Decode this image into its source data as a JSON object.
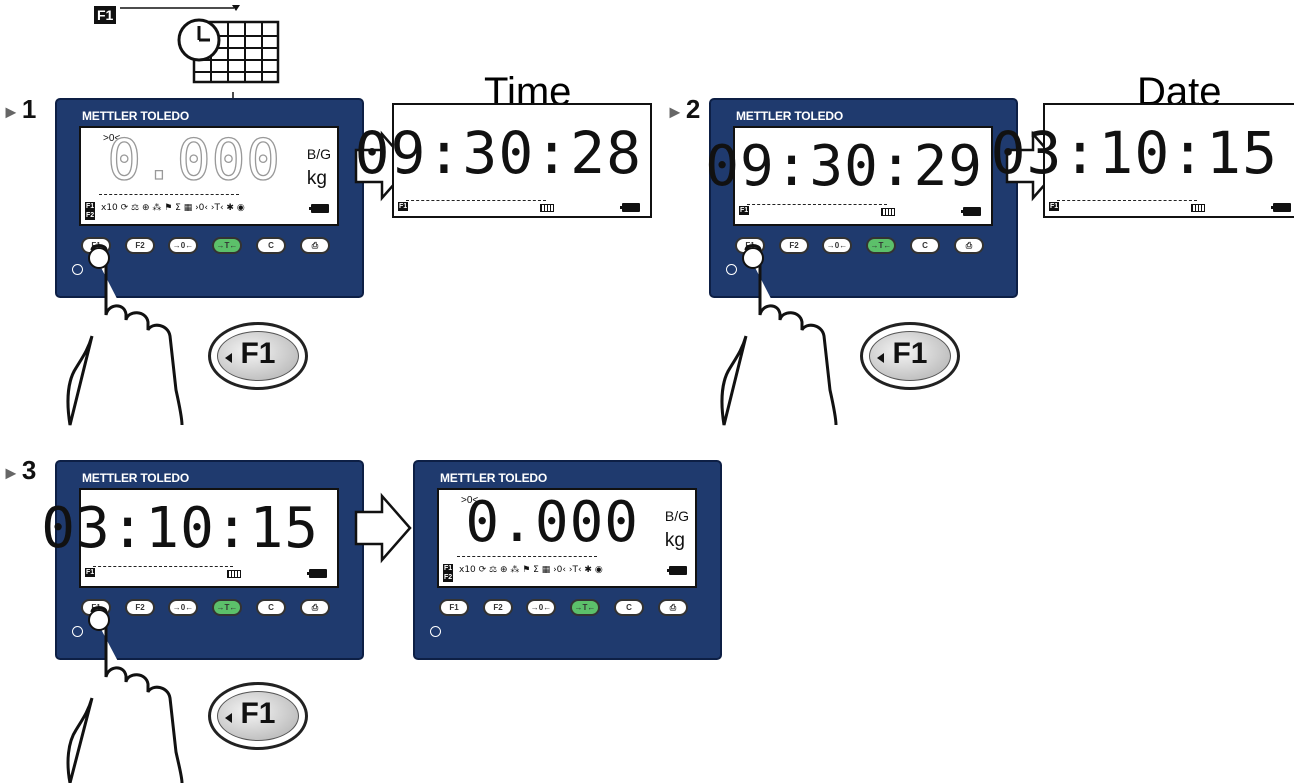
{
  "top_icon": {
    "tag": "F1",
    "icon": "clock-calendar-icon"
  },
  "labels": {
    "time": "Time",
    "date": "Date"
  },
  "steps": [
    {
      "label": "1"
    },
    {
      "label": "2"
    },
    {
      "label": "3"
    }
  ],
  "terminal": {
    "brand": "METTLER TOLEDO",
    "keys": [
      "F1",
      "F2",
      "→0←",
      "→T←",
      "C",
      "⎙"
    ],
    "f1_tag": "F1",
    "f2_tag": "F2"
  },
  "displays": {
    "step1": {
      "weight": "0.000",
      "unit_top": "B/G",
      "unit_bottom": "kg",
      "zero": ">0<",
      "icons": "x10 ⟳ ⚖ ⊕ ⁂ ⚑ Σ ▦ ›0‹ ›T‹ ✱ ◉"
    },
    "time_display": {
      "value": "09:30:28"
    },
    "step2": {
      "value": "09:30:29"
    },
    "date_display": {
      "value": "03:10:15"
    },
    "step3": {
      "value": "03:10:15"
    },
    "final": {
      "weight": "0.000",
      "unit_top": "B/G",
      "unit_bottom": "kg",
      "zero": ">0<",
      "icons": "x10 ⟳ ⚖ ⊕ ⁂ ⚑ Σ ▦ ›0‹ ›T‹ ✱ ◉"
    }
  },
  "callout_label": "F1"
}
